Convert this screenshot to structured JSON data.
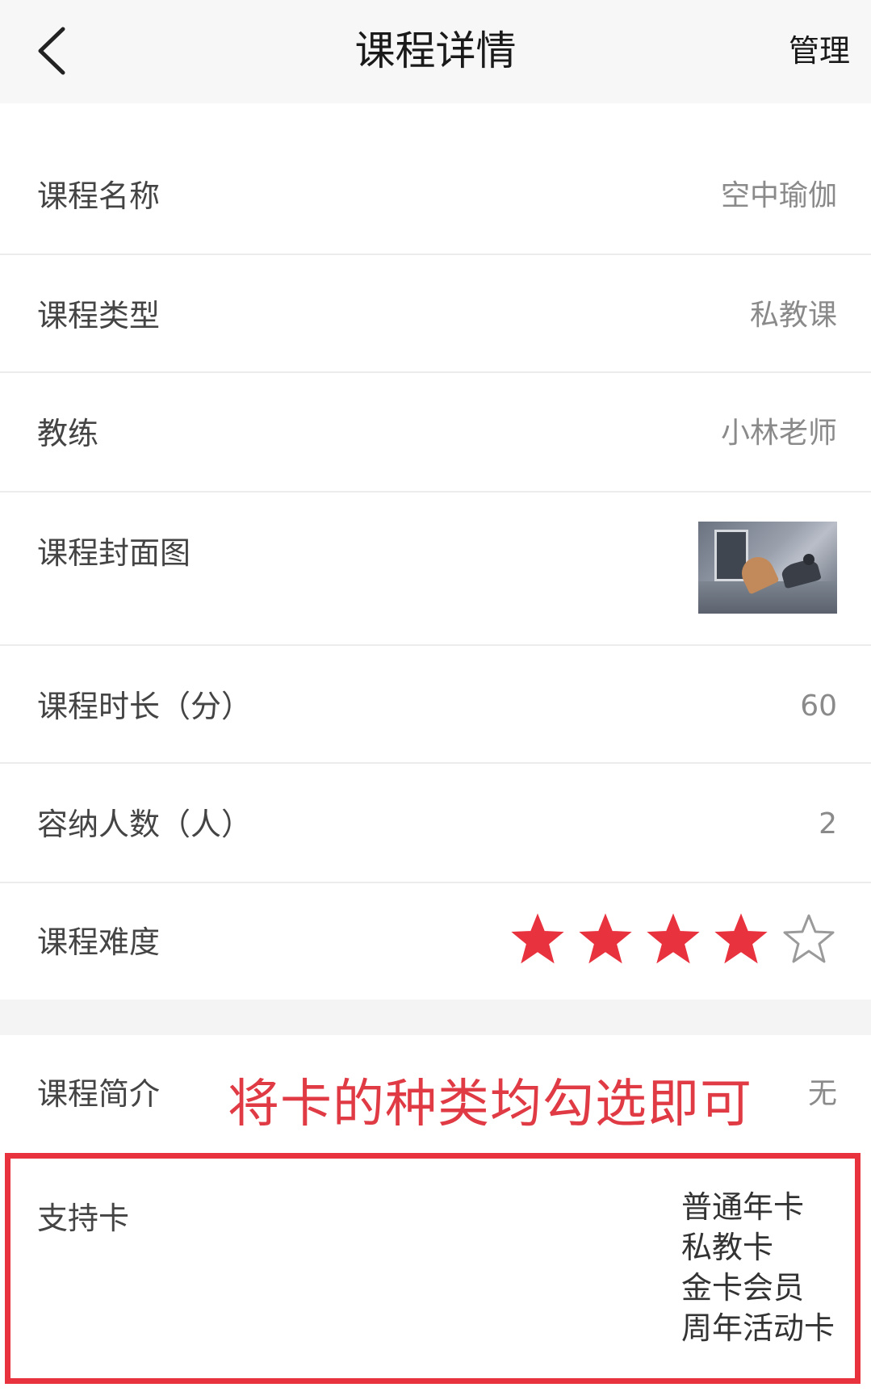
{
  "header": {
    "title": "课程详情",
    "manage_label": "管理",
    "back_icon": "chevron-left-icon"
  },
  "rows": {
    "course_name": {
      "label": "课程名称",
      "value": "空中瑜伽"
    },
    "course_type": {
      "label": "课程类型",
      "value": "私教课"
    },
    "coach": {
      "label": "教练",
      "value": "小林老师"
    },
    "cover": {
      "label": "课程封面图"
    },
    "duration": {
      "label": "课程时长（分）",
      "value": "60"
    },
    "capacity": {
      "label": "容纳人数（人）",
      "value": "2"
    },
    "difficulty": {
      "label": "课程难度",
      "rating": 4,
      "max": 5,
      "star_color": "#e8323e"
    },
    "intro": {
      "label": "课程简介",
      "value": "无"
    },
    "cards": {
      "label": "支持卡",
      "items": [
        "普通年卡",
        "私教卡",
        "金卡会员",
        "周年活动卡"
      ]
    }
  },
  "annotation": {
    "text": "将卡的种类均勾选即可",
    "color": "#e03a44"
  }
}
